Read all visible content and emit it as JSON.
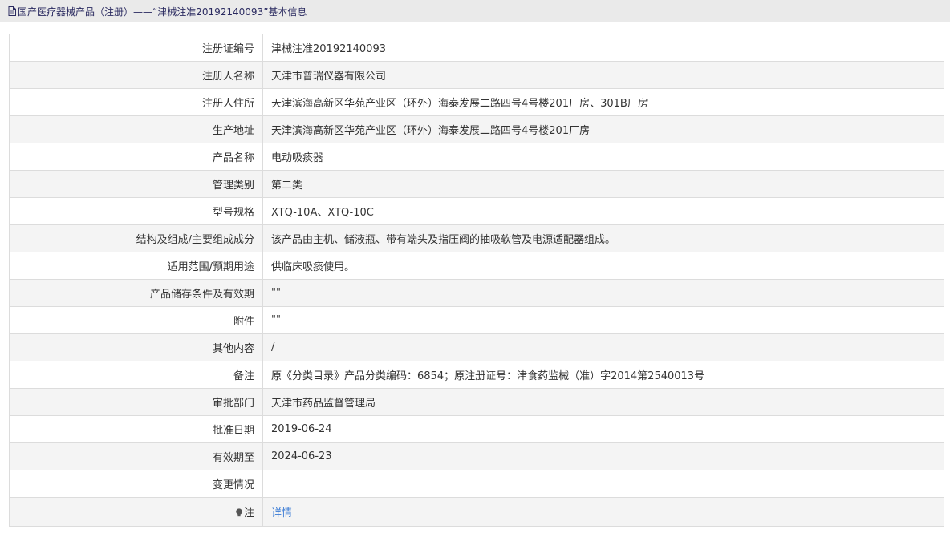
{
  "header": {
    "title": "国产医疗器械产品（注册）——“津械注准20192140093”基本信息"
  },
  "rows": [
    {
      "label": "注册证编号",
      "value": "津械注准20192140093"
    },
    {
      "label": "注册人名称",
      "value": "天津市普瑞仪器有限公司"
    },
    {
      "label": "注册人住所",
      "value": "天津滨海高新区华苑产业区（环外）海泰发展二路四号4号楼201厂房、301B厂房"
    },
    {
      "label": "生产地址",
      "value": "天津滨海高新区华苑产业区（环外）海泰发展二路四号4号楼201厂房"
    },
    {
      "label": "产品名称",
      "value": "电动吸痰器"
    },
    {
      "label": "管理类别",
      "value": "第二类"
    },
    {
      "label": "型号规格",
      "value": "XTQ-10A、XTQ-10C"
    },
    {
      "label": "结构及组成/主要组成成分",
      "value": "该产品由主机、储液瓶、带有端头及指压阀的抽吸软管及电源适配器组成。"
    },
    {
      "label": "适用范围/预期用途",
      "value": "供临床吸痰使用。"
    },
    {
      "label": "产品储存条件及有效期",
      "value": "\"\""
    },
    {
      "label": "附件",
      "value": "\"\""
    },
    {
      "label": "其他内容",
      "value": "/"
    },
    {
      "label": "备注",
      "value": "原《分类目录》产品分类编码：6854；原注册证号：津食药监械（准）字2014第2540013号"
    },
    {
      "label": "审批部门",
      "value": "天津市药品监督管理局"
    },
    {
      "label": "批准日期",
      "value": "2019-06-24"
    },
    {
      "label": "有效期至",
      "value": "2024-06-23"
    },
    {
      "label": "变更情况",
      "value": ""
    }
  ],
  "note": {
    "label": "注",
    "link_text": "详情",
    "icon": "lightbulb-icon"
  },
  "colors": {
    "header_bg": "#eaeaea",
    "header_text": "#2a2a60",
    "row_alt_bg": "#f4f4f4",
    "border": "#dcdcdc",
    "link": "#3a7bd5"
  }
}
